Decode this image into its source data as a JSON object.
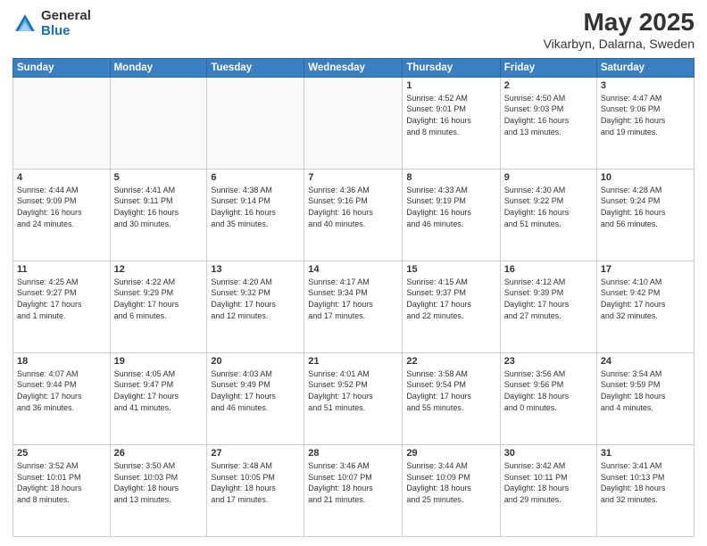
{
  "header": {
    "logo_general": "General",
    "logo_blue": "Blue",
    "title": "May 2025",
    "subtitle": "Vikarbyn, Dalarna, Sweden"
  },
  "days": [
    "Sunday",
    "Monday",
    "Tuesday",
    "Wednesday",
    "Thursday",
    "Friday",
    "Saturday"
  ],
  "weeks": [
    [
      {
        "date": "",
        "info": ""
      },
      {
        "date": "",
        "info": ""
      },
      {
        "date": "",
        "info": ""
      },
      {
        "date": "",
        "info": ""
      },
      {
        "date": "1",
        "info": "Sunrise: 4:52 AM\nSunset: 9:01 PM\nDaylight: 16 hours\nand 8 minutes."
      },
      {
        "date": "2",
        "info": "Sunrise: 4:50 AM\nSunset: 9:03 PM\nDaylight: 16 hours\nand 13 minutes."
      },
      {
        "date": "3",
        "info": "Sunrise: 4:47 AM\nSunset: 9:06 PM\nDaylight: 16 hours\nand 19 minutes."
      }
    ],
    [
      {
        "date": "4",
        "info": "Sunrise: 4:44 AM\nSunset: 9:09 PM\nDaylight: 16 hours\nand 24 minutes."
      },
      {
        "date": "5",
        "info": "Sunrise: 4:41 AM\nSunset: 9:11 PM\nDaylight: 16 hours\nand 30 minutes."
      },
      {
        "date": "6",
        "info": "Sunrise: 4:38 AM\nSunset: 9:14 PM\nDaylight: 16 hours\nand 35 minutes."
      },
      {
        "date": "7",
        "info": "Sunrise: 4:36 AM\nSunset: 9:16 PM\nDaylight: 16 hours\nand 40 minutes."
      },
      {
        "date": "8",
        "info": "Sunrise: 4:33 AM\nSunset: 9:19 PM\nDaylight: 16 hours\nand 46 minutes."
      },
      {
        "date": "9",
        "info": "Sunrise: 4:30 AM\nSunset: 9:22 PM\nDaylight: 16 hours\nand 51 minutes."
      },
      {
        "date": "10",
        "info": "Sunrise: 4:28 AM\nSunset: 9:24 PM\nDaylight: 16 hours\nand 56 minutes."
      }
    ],
    [
      {
        "date": "11",
        "info": "Sunrise: 4:25 AM\nSunset: 9:27 PM\nDaylight: 17 hours\nand 1 minute."
      },
      {
        "date": "12",
        "info": "Sunrise: 4:22 AM\nSunset: 9:29 PM\nDaylight: 17 hours\nand 6 minutes."
      },
      {
        "date": "13",
        "info": "Sunrise: 4:20 AM\nSunset: 9:32 PM\nDaylight: 17 hours\nand 12 minutes."
      },
      {
        "date": "14",
        "info": "Sunrise: 4:17 AM\nSunset: 9:34 PM\nDaylight: 17 hours\nand 17 minutes."
      },
      {
        "date": "15",
        "info": "Sunrise: 4:15 AM\nSunset: 9:37 PM\nDaylight: 17 hours\nand 22 minutes."
      },
      {
        "date": "16",
        "info": "Sunrise: 4:12 AM\nSunset: 9:39 PM\nDaylight: 17 hours\nand 27 minutes."
      },
      {
        "date": "17",
        "info": "Sunrise: 4:10 AM\nSunset: 9:42 PM\nDaylight: 17 hours\nand 32 minutes."
      }
    ],
    [
      {
        "date": "18",
        "info": "Sunrise: 4:07 AM\nSunset: 9:44 PM\nDaylight: 17 hours\nand 36 minutes."
      },
      {
        "date": "19",
        "info": "Sunrise: 4:05 AM\nSunset: 9:47 PM\nDaylight: 17 hours\nand 41 minutes."
      },
      {
        "date": "20",
        "info": "Sunrise: 4:03 AM\nSunset: 9:49 PM\nDaylight: 17 hours\nand 46 minutes."
      },
      {
        "date": "21",
        "info": "Sunrise: 4:01 AM\nSunset: 9:52 PM\nDaylight: 17 hours\nand 51 minutes."
      },
      {
        "date": "22",
        "info": "Sunrise: 3:58 AM\nSunset: 9:54 PM\nDaylight: 17 hours\nand 55 minutes."
      },
      {
        "date": "23",
        "info": "Sunrise: 3:56 AM\nSunset: 9:56 PM\nDaylight: 18 hours\nand 0 minutes."
      },
      {
        "date": "24",
        "info": "Sunrise: 3:54 AM\nSunset: 9:59 PM\nDaylight: 18 hours\nand 4 minutes."
      }
    ],
    [
      {
        "date": "25",
        "info": "Sunrise: 3:52 AM\nSunset: 10:01 PM\nDaylight: 18 hours\nand 8 minutes."
      },
      {
        "date": "26",
        "info": "Sunrise: 3:50 AM\nSunset: 10:03 PM\nDaylight: 18 hours\nand 13 minutes."
      },
      {
        "date": "27",
        "info": "Sunrise: 3:48 AM\nSunset: 10:05 PM\nDaylight: 18 hours\nand 17 minutes."
      },
      {
        "date": "28",
        "info": "Sunrise: 3:46 AM\nSunset: 10:07 PM\nDaylight: 18 hours\nand 21 minutes."
      },
      {
        "date": "29",
        "info": "Sunrise: 3:44 AM\nSunset: 10:09 PM\nDaylight: 18 hours\nand 25 minutes."
      },
      {
        "date": "30",
        "info": "Sunrise: 3:42 AM\nSunset: 10:11 PM\nDaylight: 18 hours\nand 29 minutes."
      },
      {
        "date": "31",
        "info": "Sunrise: 3:41 AM\nSunset: 10:13 PM\nDaylight: 18 hours\nand 32 minutes."
      }
    ]
  ]
}
